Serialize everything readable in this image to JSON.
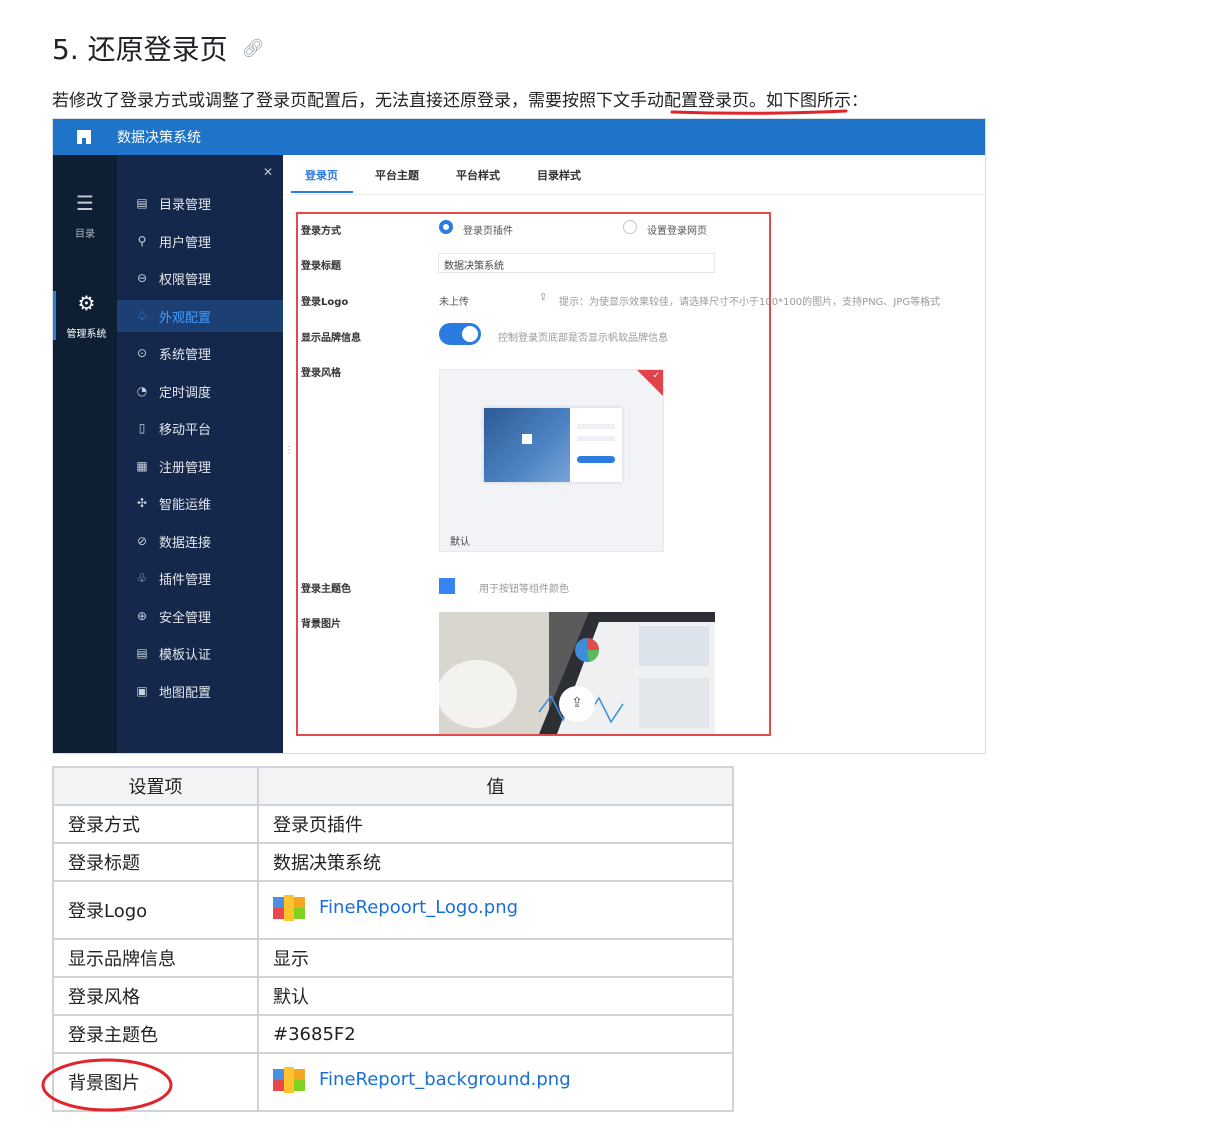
{
  "heading": {
    "text": "5. 还原登录页",
    "link_icon": "link-icon"
  },
  "intro": {
    "before": "若修改了登录方式或调整了登录页配置后，无法直接还原登录，需要按照下",
    "highlight": "文手动配置登录页。",
    "after": "如下图所示："
  },
  "screenshot": {
    "app_title": "数据决策系统",
    "rail": [
      {
        "label": "目录",
        "icon": "list-icon"
      },
      {
        "label": "管理系统",
        "icon": "gear-icon",
        "active": true
      }
    ],
    "menu": [
      {
        "label": "目录管理",
        "icon": "directory-icon"
      },
      {
        "label": "用户管理",
        "icon": "user-icon"
      },
      {
        "label": "权限管理",
        "icon": "lock-icon"
      },
      {
        "label": "外观配置",
        "icon": "palette-icon",
        "active": true
      },
      {
        "label": "系统管理",
        "icon": "settings-icon"
      },
      {
        "label": "定时调度",
        "icon": "timer-icon"
      },
      {
        "label": "移动平台",
        "icon": "mobile-icon"
      },
      {
        "label": "注册管理",
        "icon": "register-icon"
      },
      {
        "label": "智能运维",
        "icon": "ops-icon"
      },
      {
        "label": "数据连接",
        "icon": "attach-icon"
      },
      {
        "label": "插件管理",
        "icon": "plugin-icon"
      },
      {
        "label": "安全管理",
        "icon": "shield-icon"
      },
      {
        "label": "模板认证",
        "icon": "template-icon"
      },
      {
        "label": "地图配置",
        "icon": "map-icon"
      }
    ],
    "tabs": [
      "登录页",
      "平台主题",
      "平台样式",
      "目录样式"
    ],
    "form": {
      "login_method_label": "登录方式",
      "login_method_opt1": "登录页插件",
      "login_method_opt2": "设置登录网页",
      "login_title_label": "登录标题",
      "login_title_value": "数据决策系统",
      "logo_label": "登录Logo",
      "logo_value": "未上传",
      "logo_hint": "提示：为使显示效果较佳，请选择尺寸不小于100*100的图片，支持PNG、JPG等格式",
      "brand_label": "显示品牌信息",
      "brand_hint": "控制登录页底部是否显示帆软品牌信息",
      "style_label": "登录风格",
      "style_name": "默认",
      "theme_label": "登录主题色",
      "theme_hint": "用于按钮等组件颜色",
      "theme_color": "#3685F2",
      "bg_label": "背景图片"
    }
  },
  "table": {
    "headers": [
      "设置项",
      "值"
    ],
    "rows": [
      {
        "key": "登录方式",
        "value": "登录页插件"
      },
      {
        "key": "登录标题",
        "value": "数据决策系统"
      },
      {
        "key": "登录Logo",
        "value": "FineRepoort_Logo.png",
        "file": true
      },
      {
        "key": "显示品牌信息",
        "value": "显示"
      },
      {
        "key": "登录风格",
        "value": "默认"
      },
      {
        "key": "登录主题色",
        "value": "#3685F2"
      },
      {
        "key": "背景图片",
        "value": "FineReport_background.png",
        "file": true
      }
    ]
  },
  "colors": {
    "accent": "#2b7be0",
    "annotation_red": "#e0252b",
    "link": "#1a6fd6"
  }
}
